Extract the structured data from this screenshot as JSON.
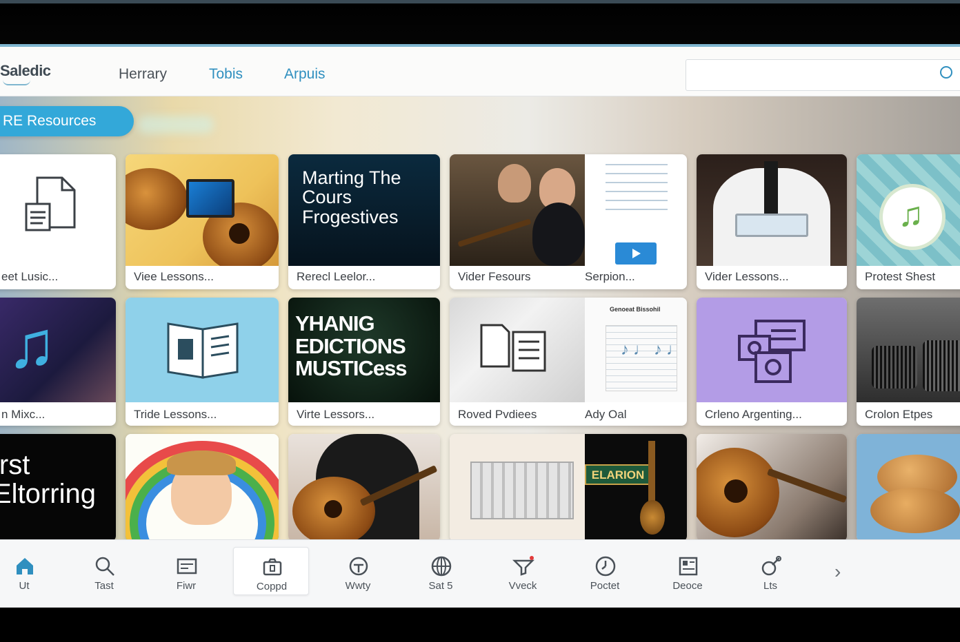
{
  "header": {
    "logo": "Saledic",
    "nav": [
      "Herrary",
      "Tobis",
      "Arpuis"
    ],
    "search_placeholder": ""
  },
  "section_label": "RE Resources",
  "cards": [
    {
      "caption": "eet Lusic...",
      "thumb_text": ""
    },
    {
      "caption": "Viee Lessons...",
      "thumb_text": ""
    },
    {
      "caption": "Rerecl Leelor...",
      "thumb_text": "Marting The Cours Frogestives"
    },
    {
      "caption": "Vider Fesours",
      "thumb_text": ""
    },
    {
      "caption": "Serpion...",
      "thumb_text": ""
    },
    {
      "caption": "Vider Lessons...",
      "thumb_text": ""
    },
    {
      "caption": "Protest Shest",
      "thumb_text": ""
    },
    {
      "caption": "n Mixc...",
      "thumb_text": ""
    },
    {
      "caption": "Tride Lessons...",
      "thumb_text": ""
    },
    {
      "caption": "Virte Lessors...",
      "thumb_text": "YHANIG EDICTIONS MUSTICess"
    },
    {
      "caption": "Roved Pvdiees",
      "thumb_text": ""
    },
    {
      "caption": "Ady Oal",
      "thumb_text": "Genoeat Bissohil"
    },
    {
      "caption": "Crleno Argenting...",
      "thumb_text": ""
    },
    {
      "caption": "Crolon Etpes",
      "thumb_text": ""
    },
    {
      "caption": "",
      "thumb_text": "irst Eltorring"
    },
    {
      "caption": "",
      "thumb_text": ""
    },
    {
      "caption": "",
      "thumb_text": ""
    },
    {
      "caption": "",
      "thumb_text": "ELARION"
    },
    {
      "caption": "",
      "thumb_text": ""
    },
    {
      "caption": "",
      "thumb_text": ""
    }
  ],
  "bottom_nav": [
    {
      "label": "Ut",
      "icon": "home-icon",
      "active": false
    },
    {
      "label": "Tast",
      "icon": "search-icon",
      "active": false
    },
    {
      "label": "Fiwr",
      "icon": "card-icon",
      "active": false
    },
    {
      "label": "Coppd",
      "icon": "camera-icon",
      "active": true
    },
    {
      "label": "Wwty",
      "icon": "target-icon",
      "active": false
    },
    {
      "label": "Sat 5",
      "icon": "globe-icon",
      "active": false
    },
    {
      "label": "Vveck",
      "icon": "filter-icon",
      "active": false
    },
    {
      "label": "Poctet",
      "icon": "clock-icon",
      "active": false
    },
    {
      "label": "Deoce",
      "icon": "grid-icon",
      "active": false
    },
    {
      "label": "Lts",
      "icon": "tools-icon",
      "active": false
    }
  ],
  "colors": {
    "accent": "#33a8d9",
    "nav_active": "#2f8fbf",
    "home_icon": "#2f8fbf",
    "badge": "#e23a3a"
  }
}
